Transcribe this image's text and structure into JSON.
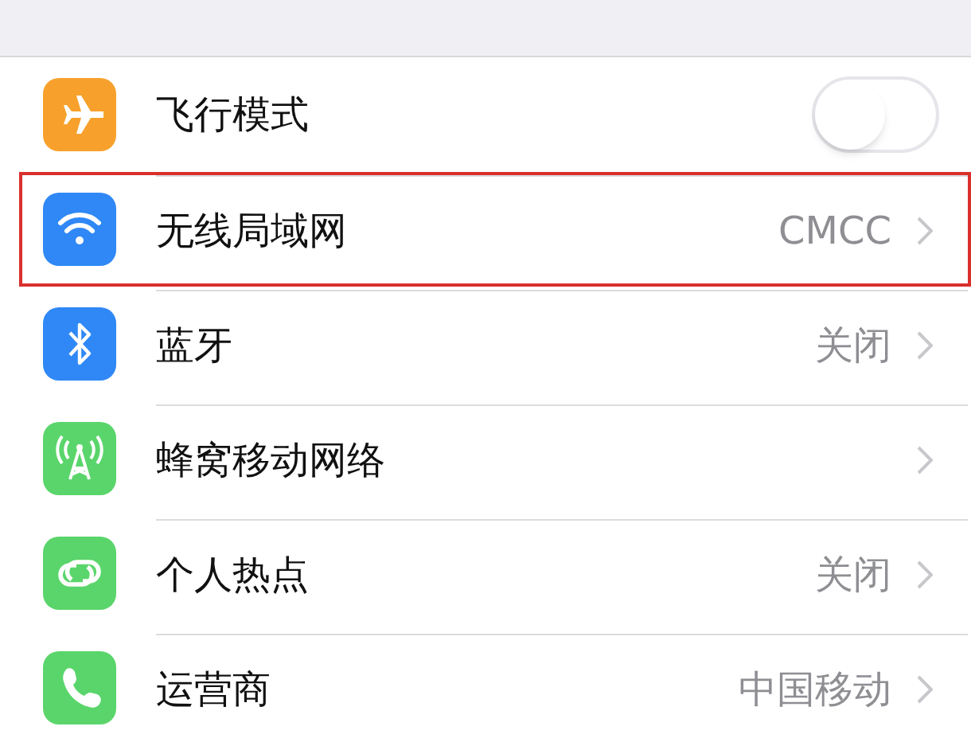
{
  "rows": [
    {
      "color": "#f7a12c",
      "label": "飞行模式",
      "kind": "toggle",
      "on": false,
      "highlighted": false
    },
    {
      "color": "#2f88f5",
      "label": "无线局域网",
      "kind": "link",
      "value": "CMCC",
      "highlighted": true
    },
    {
      "color": "#2f88f5",
      "label": "蓝牙",
      "kind": "link",
      "value": "关闭",
      "highlighted": false
    },
    {
      "color": "#5ad56b",
      "label": "蜂窝移动网络",
      "kind": "link",
      "highlighted": false
    },
    {
      "color": "#5ad56b",
      "label": "个人热点",
      "kind": "link",
      "value": "关闭",
      "highlighted": false
    },
    {
      "color": "#5ad56b",
      "label": "运营商",
      "kind": "link",
      "value": "中国移动",
      "highlighted": false
    }
  ]
}
